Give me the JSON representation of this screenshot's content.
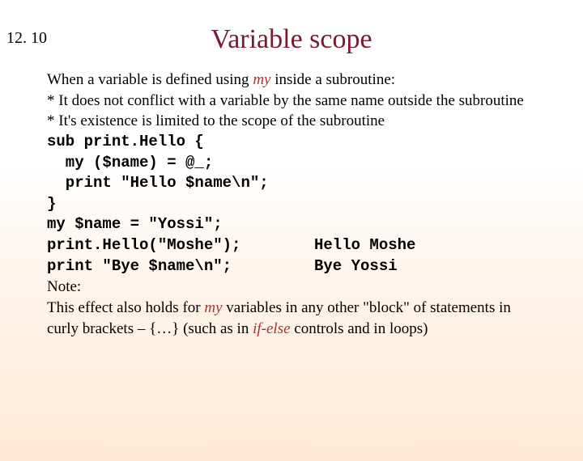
{
  "slide_number": "12. 10",
  "title": "Variable scope",
  "intro": {
    "line1_pre": "When a variable is defined using ",
    "line1_kw": "my",
    "line1_post": " inside a subroutine:",
    "bullet1": " * It does not conflict with a variable by the same name outside the subroutine",
    "bullet2": " * It's existence is limited to the scope of the subroutine"
  },
  "code": {
    "l1": "sub print.Hello {",
    "l2": "  my ($name) = @_;",
    "l3": "  print \"Hello $name\\n\";",
    "l4": "}",
    "l5": "my $name = \"Yossi\";",
    "l6": "print.Hello(\"Moshe\");",
    "l7": "print \"Bye $name\\n\";"
  },
  "output": {
    "o1": "Hello Moshe",
    "o2": "Bye Yossi"
  },
  "note": {
    "n1": "Note:",
    "n2_pre": "This effect also holds for ",
    "n2_kw": "my",
    "n2_post": " variables in any other \"block\" of statements in",
    "n3_pre": "curly brackets – {…}    (such as in ",
    "n3_kw": "if-else",
    "n3_post": " controls and in loops)"
  }
}
